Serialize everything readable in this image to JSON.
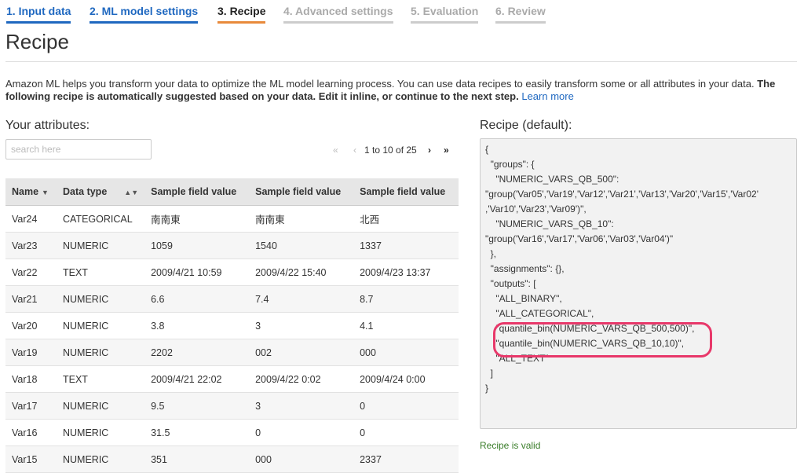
{
  "wizard": {
    "steps": [
      {
        "label": "1. Input data",
        "state": "done"
      },
      {
        "label": "2. ML model settings",
        "state": "done"
      },
      {
        "label": "3. Recipe",
        "state": "active"
      },
      {
        "label": "4. Advanced settings",
        "state": "pending"
      },
      {
        "label": "5. Evaluation",
        "state": "pending"
      },
      {
        "label": "6. Review",
        "state": "pending"
      }
    ]
  },
  "page": {
    "title": "Recipe",
    "intro_text": "Amazon ML helps you transform your data to optimize the ML model learning process. You can use data recipes to easily transform some or all attributes in your data.",
    "intro_bold": "The following recipe is automatically suggested based on your data. Edit it inline, or continue to the next step.",
    "learn_more": "Learn more"
  },
  "attributes": {
    "heading": "Your attributes:",
    "search_placeholder": "search here",
    "pager": {
      "first": "«",
      "prev": "‹",
      "range": "1 to 10 of 25",
      "next": "›",
      "last": "»"
    },
    "columns": [
      "Name",
      "Data type",
      "Sample field value",
      "Sample field value",
      "Sample field value"
    ],
    "rows": [
      [
        "Var24",
        "CATEGORICAL",
        "南南東",
        "南南東",
        "北西"
      ],
      [
        "Var23",
        "NUMERIC",
        "1059",
        "1540",
        "1337"
      ],
      [
        "Var22",
        "TEXT",
        "2009/4/21 10:59",
        "2009/4/22 15:40",
        "2009/4/23 13:37"
      ],
      [
        "Var21",
        "NUMERIC",
        "6.6",
        "7.4",
        "8.7"
      ],
      [
        "Var20",
        "NUMERIC",
        "3.8",
        "3",
        "4.1"
      ],
      [
        "Var19",
        "NUMERIC",
        "2202",
        "002",
        "000"
      ],
      [
        "Var18",
        "TEXT",
        "2009/4/21 22:02",
        "2009/4/22 0:02",
        "2009/4/24 0:00"
      ],
      [
        "Var17",
        "NUMERIC",
        "9.5",
        "3",
        "0"
      ],
      [
        "Var16",
        "NUMERIC",
        "31.5",
        "0",
        "0"
      ],
      [
        "Var15",
        "NUMERIC",
        "351",
        "000",
        "2337"
      ]
    ]
  },
  "recipe": {
    "heading": "Recipe (default):",
    "lines": [
      "{",
      "  \"groups\": {",
      "    \"NUMERIC_VARS_QB_500\":",
      "\"group('Var05','Var19','Var12','Var21','Var13','Var20','Var15','Var02'",
      ",'Var10','Var23','Var09')\",",
      "    \"NUMERIC_VARS_QB_10\":",
      "\"group('Var16','Var17','Var06','Var03','Var04')\"",
      "  },",
      "  \"assignments\": {},",
      "  \"outputs\": [",
      "    \"ALL_BINARY\",",
      "    \"ALL_CATEGORICAL\",",
      "    \"quantile_bin(NUMERIC_VARS_QB_500,500)\",",
      "    \"quantile_bin(NUMERIC_VARS_QB_10,10)\",",
      "    \"ALL_TEXT\"",
      "  ]",
      "}"
    ],
    "status": "Recipe is valid",
    "highlight_color": "#e8386a"
  }
}
